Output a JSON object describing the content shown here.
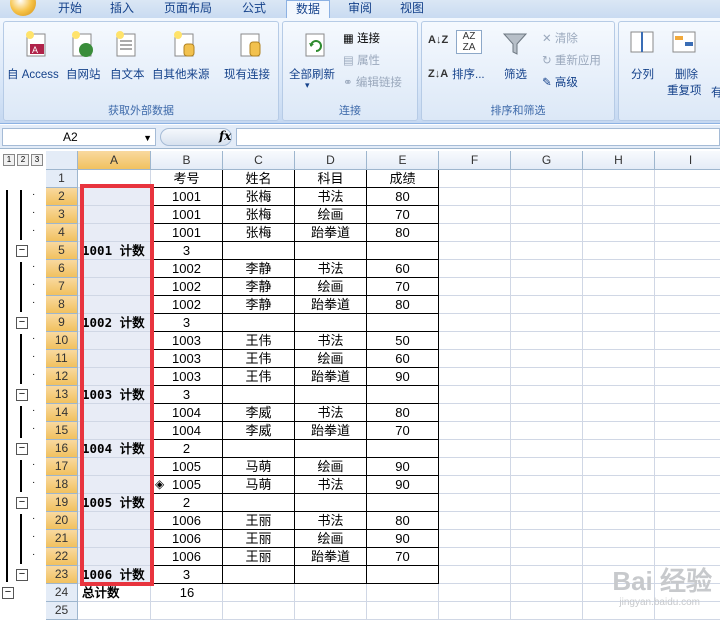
{
  "ribbon_tabs": [
    "开始",
    "插入",
    "页面布局",
    "公式",
    "数据",
    "审阅",
    "视图"
  ],
  "active_tab": "数据",
  "groups": {
    "external": {
      "label": "获取外部数据",
      "buttons": [
        "自 Access",
        "自网站",
        "自文本",
        "自其他来源",
        "现有连接"
      ]
    },
    "connections": {
      "label": "连接",
      "big": "全部刷新",
      "small": [
        "连接",
        "属性",
        "编辑链接"
      ]
    },
    "sortfilter": {
      "label": "排序和筛选",
      "sort": "排序...",
      "filter": "筛选",
      "small": [
        "清除",
        "重新应用",
        "高级"
      ]
    },
    "tools": {
      "buttons": [
        "分列",
        "删除",
        "重复项"
      ],
      "truncated": "有"
    }
  },
  "formula_bar": {
    "name_box": "A2",
    "fx": "fx",
    "formula": ""
  },
  "outline_levels": [
    "1",
    "2",
    "3"
  ],
  "columns": [
    "A",
    "B",
    "C",
    "D",
    "E",
    "F",
    "G",
    "H",
    "I"
  ],
  "selected_column": "A",
  "header_row": {
    "b": "考号",
    "c": "姓名",
    "d": "科目",
    "e": "成绩"
  },
  "rows": [
    {
      "n": "2",
      "a": "",
      "b": "1001",
      "c": "张梅",
      "d": "书法",
      "e": "80"
    },
    {
      "n": "3",
      "a": "",
      "b": "1001",
      "c": "张梅",
      "d": "绘画",
      "e": "70"
    },
    {
      "n": "4",
      "a": "",
      "b": "1001",
      "c": "张梅",
      "d": "跆拳道",
      "e": "80"
    },
    {
      "n": "5",
      "a": "1001 计数",
      "b": "3",
      "c": "",
      "d": "",
      "e": ""
    },
    {
      "n": "6",
      "a": "",
      "b": "1002",
      "c": "李静",
      "d": "书法",
      "e": "60"
    },
    {
      "n": "7",
      "a": "",
      "b": "1002",
      "c": "李静",
      "d": "绘画",
      "e": "70"
    },
    {
      "n": "8",
      "a": "",
      "b": "1002",
      "c": "李静",
      "d": "跆拳道",
      "e": "80"
    },
    {
      "n": "9",
      "a": "1002 计数",
      "b": "3",
      "c": "",
      "d": "",
      "e": ""
    },
    {
      "n": "10",
      "a": "",
      "b": "1003",
      "c": "王伟",
      "d": "书法",
      "e": "50"
    },
    {
      "n": "11",
      "a": "",
      "b": "1003",
      "c": "王伟",
      "d": "绘画",
      "e": "60"
    },
    {
      "n": "12",
      "a": "",
      "b": "1003",
      "c": "王伟",
      "d": "跆拳道",
      "e": "90"
    },
    {
      "n": "13",
      "a": "1003 计数",
      "b": "3",
      "c": "",
      "d": "",
      "e": ""
    },
    {
      "n": "14",
      "a": "",
      "b": "1004",
      "c": "李威",
      "d": "书法",
      "e": "80"
    },
    {
      "n": "15",
      "a": "",
      "b": "1004",
      "c": "李威",
      "d": "跆拳道",
      "e": "70"
    },
    {
      "n": "16",
      "a": "1004 计数",
      "b": "2",
      "c": "",
      "d": "",
      "e": ""
    },
    {
      "n": "17",
      "a": "",
      "b": "1005",
      "c": "马萌",
      "d": "绘画",
      "e": "90"
    },
    {
      "n": "18",
      "a": "",
      "b": "1005",
      "c": "马萌",
      "d": "书法",
      "e": "90"
    },
    {
      "n": "19",
      "a": "1005 计数",
      "b": "2",
      "c": "",
      "d": "",
      "e": ""
    },
    {
      "n": "20",
      "a": "",
      "b": "1006",
      "c": "王丽",
      "d": "书法",
      "e": "80"
    },
    {
      "n": "21",
      "a": "",
      "b": "1006",
      "c": "王丽",
      "d": "绘画",
      "e": "90"
    },
    {
      "n": "22",
      "a": "",
      "b": "1006",
      "c": "王丽",
      "d": "跆拳道",
      "e": "70"
    },
    {
      "n": "23",
      "a": "1006 计数",
      "b": "3",
      "c": "",
      "d": "",
      "e": ""
    },
    {
      "n": "24",
      "a": "总计数",
      "b": "16",
      "c": "",
      "d": "",
      "e": ""
    },
    {
      "n": "25",
      "a": "",
      "b": "",
      "c": "",
      "d": "",
      "e": ""
    }
  ],
  "watermark": "Bai 经验",
  "watermark_sub": "jingyan.baidu.com"
}
